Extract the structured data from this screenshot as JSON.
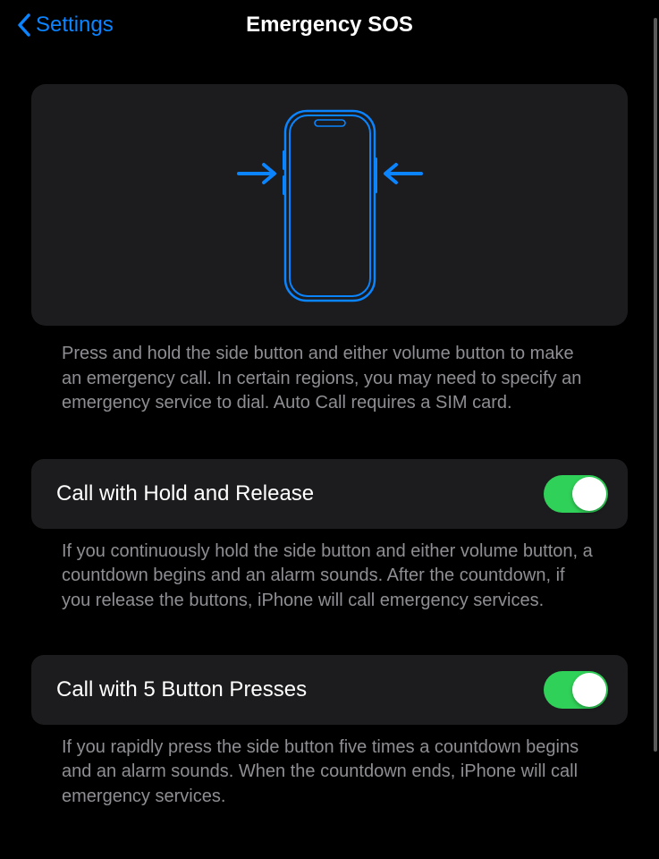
{
  "nav": {
    "back_label": "Settings",
    "title": "Emergency SOS"
  },
  "illustration": {
    "caption": "Press and hold the side button and either volume button to make an emergency call. In certain regions, you may need to specify an emergency service to dial. Auto Call requires a SIM card."
  },
  "settings": [
    {
      "label": "Call with Hold and Release",
      "enabled": true,
      "caption": "If you continuously hold the side button and either volume button, a countdown begins and an alarm sounds. After the countdown, if you release the buttons, iPhone will call emergency services."
    },
    {
      "label": "Call with 5 Button Presses",
      "enabled": true,
      "caption": "If you rapidly press the side button five times a countdown begins and an alarm sounds. When the countdown ends, iPhone will call emergency services."
    }
  ]
}
